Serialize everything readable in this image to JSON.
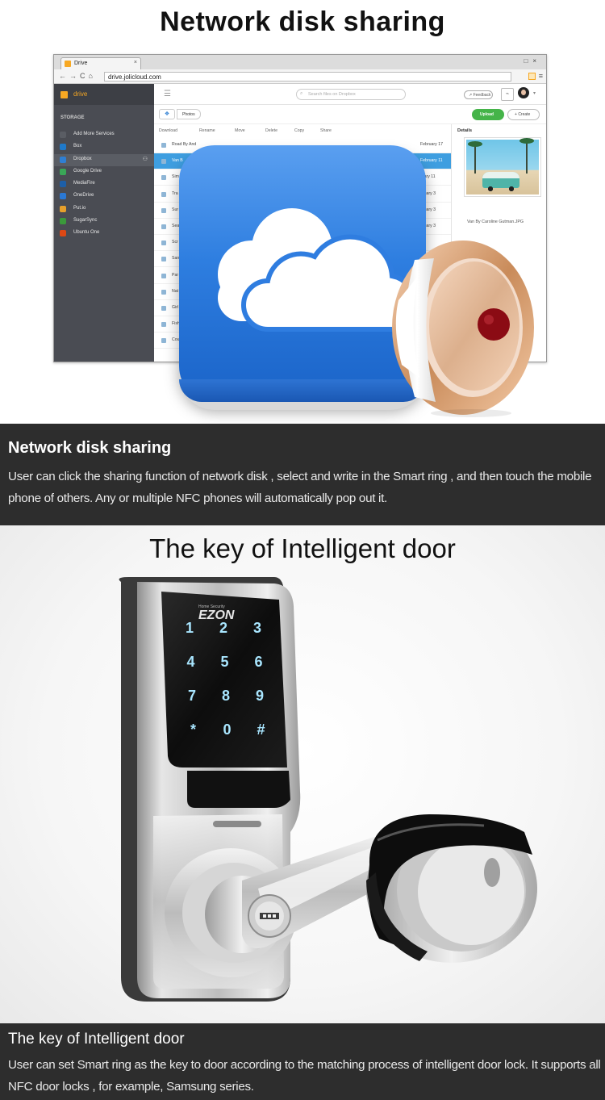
{
  "section1": {
    "title": "Network disk sharing",
    "browser": {
      "tab_label": "Drive",
      "url": "drive.jolicloud.com",
      "sidebar": {
        "brand": "drive",
        "heading": "STORAGE",
        "items": [
          {
            "label": "Add More Services",
            "icon": "plus-icon",
            "color": "#5a5d64"
          },
          {
            "label": "Box",
            "icon": "box-icon",
            "color": "#1f79c9"
          },
          {
            "label": "Dropbox",
            "icon": "dropbox-icon",
            "color": "#2f7fd3"
          },
          {
            "label": "Google Drive",
            "icon": "google-drive-icon",
            "color": "#3aa757"
          },
          {
            "label": "MediaFire",
            "icon": "mediafire-icon",
            "color": "#1d5fa8"
          },
          {
            "label": "OneDrive",
            "icon": "onedrive-icon",
            "color": "#2a78d4"
          },
          {
            "label": "Put.io",
            "icon": "putio-icon",
            "color": "#e7a02b"
          },
          {
            "label": "SugarSync",
            "icon": "sugarsync-icon",
            "color": "#3b9a3b"
          },
          {
            "label": "Ubuntu One",
            "icon": "ubuntu-one-icon",
            "color": "#dd4814"
          }
        ]
      },
      "search_placeholder": "Search files on Dropbox",
      "feedback_label": "Feedback",
      "breadcrumb": "Photos",
      "upload_label": "Upload",
      "create_label": "Create",
      "toolbar": [
        "Download",
        "Rename",
        "Move",
        "Delete",
        "Copy",
        "Share"
      ],
      "details_heading": "Details",
      "files": [
        {
          "name": "Road By And",
          "date": "February 17"
        },
        {
          "name": "Van B",
          "date": "February 11"
        },
        {
          "name": "Sim",
          "date": "ruary 11"
        },
        {
          "name": "Tra",
          "date": "bruary 3"
        },
        {
          "name": "Sur",
          "date": "bruary 3"
        },
        {
          "name": "Sea",
          "date": "bruary 3"
        },
        {
          "name": "Scr",
          "date": ""
        },
        {
          "name": "San",
          "date": ""
        },
        {
          "name": "Par",
          "date": ""
        },
        {
          "name": "Nat",
          "date": ""
        },
        {
          "name": "Girl",
          "date": ""
        },
        {
          "name": "Fish",
          "date": ""
        },
        {
          "name": "Cou",
          "date": ""
        }
      ],
      "preview_caption": "Van By Caroline Gutman.JPG"
    }
  },
  "band1": {
    "title": "Network disk sharing",
    "text": "User can click the sharing function  of network disk , select and write in the Smart ring , and  then touch the mobile phone of others. Any or multiple NFC  phones  will automatically pop out it."
  },
  "section3": {
    "title": "The key of Intelligent door",
    "lock_brand": "EZON",
    "keypad": [
      "1",
      "2",
      "3",
      "4",
      "5",
      "6",
      "7",
      "8",
      "9",
      "*",
      "0",
      "#"
    ]
  },
  "band2": {
    "title": "The key of Intelligent door",
    "text": "User can set Smart ring as the key to door according to the matching process of intelligent door lock. It supports all NFC door locks , for example, Samsung series."
  }
}
